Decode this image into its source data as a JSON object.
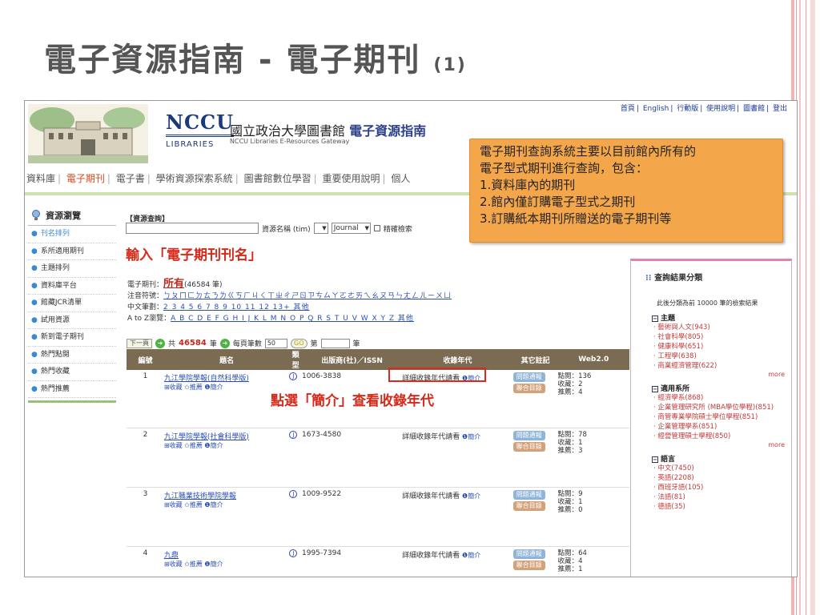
{
  "slide": {
    "title": "電子資源指南 - 電子期刊",
    "title_suffix": "(1)"
  },
  "header": {
    "logo_text": "NCCU",
    "logo_sub": "LIBRARIES",
    "site_name_prefix": "國立政治大學圖書館",
    "site_name_strong": "電子資源指南",
    "site_subtitle": "NCCU Libraries E-Resources Gateway",
    "top_links": [
      "首頁",
      "English",
      "行動版",
      "使用說明",
      "圖書館",
      "登出"
    ]
  },
  "nav": {
    "items": [
      "資料庫",
      "電子期刊",
      "電子書",
      "學術資源探索系統",
      "圖書館數位學習",
      "重要使用說明",
      "個人"
    ],
    "active": "電子期刊"
  },
  "sidebar": {
    "title": "資源瀏覽",
    "items": [
      "刊名排列",
      "系所適用期刊",
      "主題排列",
      "資料庫平台",
      "館藏JCR清單",
      "試用資源",
      "新到電子期刊",
      "熱門點閱",
      "熱門收藏",
      "熱門推薦"
    ]
  },
  "search": {
    "label": "【資源查詢】",
    "field_label": "資源名稱 (tim)",
    "type_value": "Journal",
    "exact_label": "精確檢索"
  },
  "annotations": {
    "input_note": "輸入「電子期刊刊名」",
    "intro_note": "點選「簡介」查看收錄年代"
  },
  "browse": {
    "ej_label": "電子期刊：",
    "all_link": "所有",
    "all_count": "(46584 筆)",
    "zhuyin_label": "注音符號：",
    "zhuyin_links": "ㄅㄆㄇㄈㄉㄊㄋㄌㄍㄎㄏㄐㄑㄒㄓㄔㄕㄖㄗㄘㄙㄚㄛㄜㄞㄟㄠㄡㄢㄣㄤㄥㄦㄧㄨㄩ",
    "stroke_label": "中文筆劃：",
    "stroke_links": "2 3 4 5 6 7 8 9 10 11 12 13+ 其他",
    "az_label": "A to Z瀏覽：",
    "az_links": "A B C D E F G H I J K L M N O P Q R S T U V W X Y Z 其他"
  },
  "pager": {
    "next": "下一頁",
    "total_prefix": "共",
    "total": "46584",
    "total_suffix": "筆",
    "per_page_label": "每頁筆數",
    "per_page": "50",
    "go": "GO",
    "page_prefix": "第",
    "page_suffix": "筆"
  },
  "table": {
    "headers": [
      "編號",
      "題名",
      "類型",
      "出版商(社)／ISSN",
      "收錄年代",
      "其它註記",
      "Web2.0"
    ],
    "collect": "收藏",
    "recommend": "推薦",
    "intro": "簡介",
    "years_text": "詳細收錄年代請看",
    "tag_a": "問題通報",
    "tag_b": "聯合目錄",
    "views_label": "點閱：",
    "collects_label": "收藏：",
    "recs_label": "推薦：",
    "rows": [
      {
        "no": "1",
        "title": "九江學院學報(自然科學版)",
        "type": "J",
        "issn": "1006-3838",
        "views": "136",
        "collects": "2",
        "recs": "4"
      },
      {
        "no": "2",
        "title": "九江學院學報(社會科學版)",
        "type": "J",
        "issn": "1673-4580",
        "views": "78",
        "collects": "1",
        "recs": "3"
      },
      {
        "no": "3",
        "title": "九江職業技術學院學報",
        "type": "J",
        "issn": "1009-9522",
        "views": "9",
        "collects": "1",
        "recs": "0"
      },
      {
        "no": "4",
        "title": "九鼎",
        "type": "J",
        "issn": "1995-7394",
        "views": "64",
        "collects": "4",
        "recs": "1"
      }
    ]
  },
  "facets": {
    "title": "查詢結果分類",
    "note": "此後分類為前 10000 筆的檢索結果",
    "more": "more",
    "groups": [
      {
        "name": "主題",
        "items": [
          "藝術與人文(943)",
          "社會科學(805)",
          "健康科學(651)",
          "工程學(638)",
          "商業經濟管理(622)"
        ]
      },
      {
        "name": "適用系所",
        "items": [
          "經濟學系(868)",
          "企業管理研究所 (MBA學位學程)(851)",
          "商管專業學院碩士學位學程(851)",
          "企業管理學系(851)",
          "經營管理碩士學程(850)"
        ]
      },
      {
        "name": "語言",
        "items": [
          "中文(7450)",
          "英語(2208)",
          "西班牙語(105)",
          "法語(81)",
          "德語(35)"
        ]
      }
    ]
  },
  "callout": {
    "lines": [
      "電子期刊查詢系統主要以目前館內所有的",
      "電子型式期刊進行查詢，包含：",
      "1.資料庫內的期刊",
      "2.館內僅訂購電子型式之期刊",
      "3.訂購紙本期刊所贈送的電子期刊等"
    ]
  }
}
